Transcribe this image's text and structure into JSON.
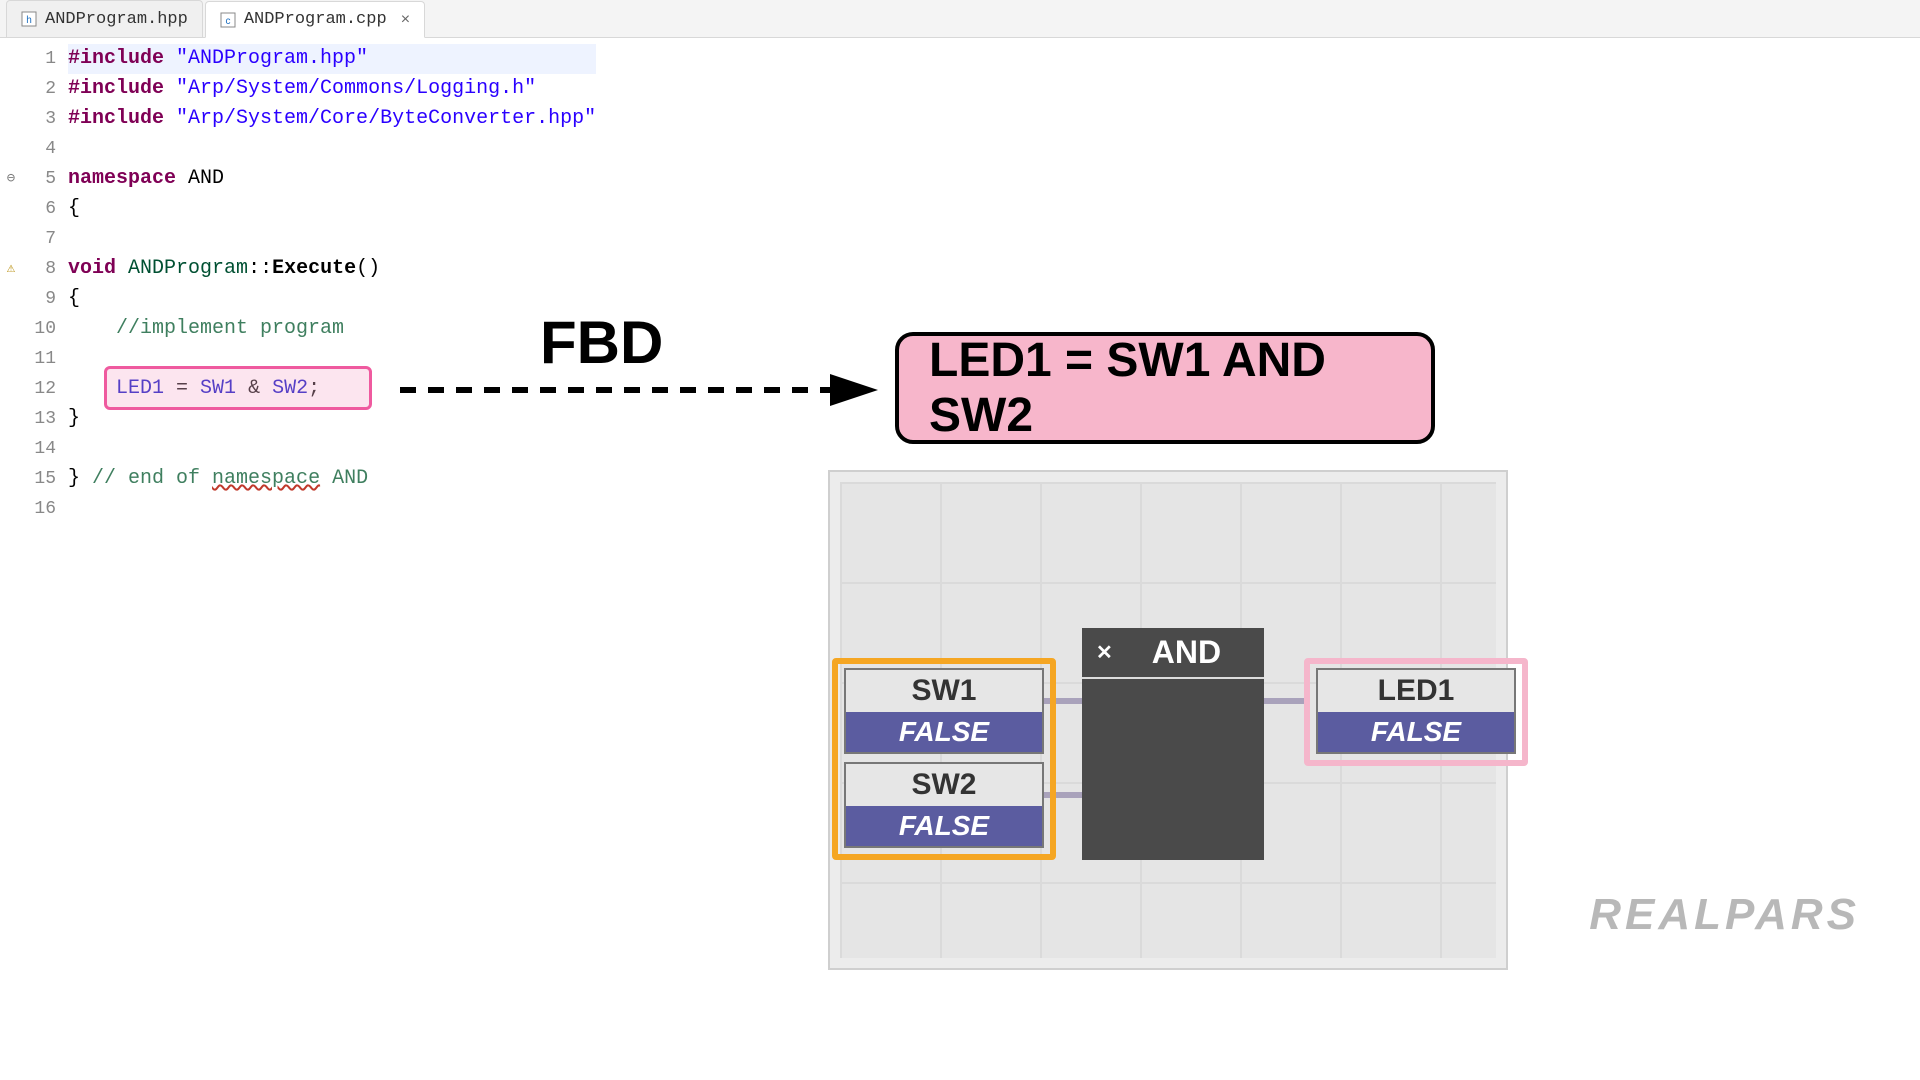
{
  "tabs": [
    {
      "label": "ANDProgram.hpp",
      "icon_letter": "h",
      "active": false,
      "closeable": false
    },
    {
      "label": "ANDProgram.cpp",
      "icon_letter": "c",
      "active": true,
      "closeable": true
    }
  ],
  "code": {
    "lines": [
      {
        "n": 1,
        "tokens": [
          [
            "dir",
            "#include "
          ],
          [
            "str",
            "\"ANDProgram.hpp\""
          ]
        ],
        "hl": true
      },
      {
        "n": 2,
        "tokens": [
          [
            "dir",
            "#include "
          ],
          [
            "str",
            "\"Arp/System/Commons/Logging.h\""
          ]
        ]
      },
      {
        "n": 3,
        "tokens": [
          [
            "dir",
            "#include "
          ],
          [
            "str",
            "\"Arp/System/Core/ByteConverter.hpp\""
          ]
        ]
      },
      {
        "n": 4,
        "tokens": []
      },
      {
        "n": 5,
        "tokens": [
          [
            "kw",
            "namespace"
          ],
          [
            "sym",
            " AND"
          ]
        ],
        "fold": "minus"
      },
      {
        "n": 6,
        "tokens": [
          [
            "sym",
            "{"
          ]
        ]
      },
      {
        "n": 7,
        "tokens": []
      },
      {
        "n": 8,
        "tokens": [
          [
            "kw",
            "void"
          ],
          [
            "sym",
            " "
          ],
          [
            "type",
            "ANDProgram"
          ],
          [
            "sym",
            "::"
          ],
          [
            "func",
            "Execute"
          ],
          [
            "sym",
            "()"
          ]
        ],
        "fold": "minus",
        "warn": true
      },
      {
        "n": 9,
        "tokens": [
          [
            "sym",
            "{"
          ]
        ]
      },
      {
        "n": 10,
        "tokens": [
          [
            "sym",
            "    "
          ],
          [
            "com",
            "//implement program"
          ]
        ]
      },
      {
        "n": 11,
        "tokens": []
      },
      {
        "n": 12,
        "tokens": [
          [
            "sym",
            "    "
          ],
          [
            "blueid",
            "LED1"
          ],
          [
            "sym",
            " = "
          ],
          [
            "blueid",
            "SW1"
          ],
          [
            "sym",
            " & "
          ],
          [
            "blueid",
            "SW2"
          ],
          [
            "sym",
            ";"
          ]
        ],
        "pinkbox": true
      },
      {
        "n": 13,
        "tokens": [
          [
            "sym",
            "}"
          ]
        ]
      },
      {
        "n": 14,
        "tokens": []
      },
      {
        "n": 15,
        "tokens": [
          [
            "sym",
            "} "
          ],
          [
            "com",
            "// end of "
          ],
          [
            "com-wavy",
            "namespace"
          ],
          [
            "com",
            " AND"
          ]
        ]
      },
      {
        "n": 16,
        "tokens": []
      }
    ]
  },
  "overlay": {
    "fbd_label": "FBD",
    "callout": "LED1 = SW1 AND SW2",
    "and_block": "AND",
    "inputs": [
      {
        "name": "SW1",
        "value": "FALSE"
      },
      {
        "name": "SW2",
        "value": "FALSE"
      }
    ],
    "output": {
      "name": "LED1",
      "value": "FALSE"
    }
  },
  "watermark": "REALPARS"
}
